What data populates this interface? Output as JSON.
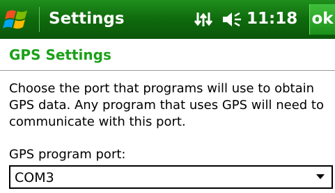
{
  "titlebar": {
    "title": "Settings",
    "clock": "11:18",
    "ok_label": "ok",
    "start_icon": "windows-flag-icon",
    "connectivity_icon": "connectivity-arrows-icon",
    "volume_icon": "volume-speaker-icon"
  },
  "page": {
    "title": "GPS Settings",
    "description": "Choose the port that programs will use to obtain GPS data. Any program that uses GPS will need to communicate with this port."
  },
  "gps_port": {
    "label": "GPS program port:",
    "selected": "COM3"
  },
  "colors": {
    "titlebar": "#0f6a0d",
    "accent": "#1aa118",
    "text": "#000000",
    "background": "#ffffff"
  }
}
